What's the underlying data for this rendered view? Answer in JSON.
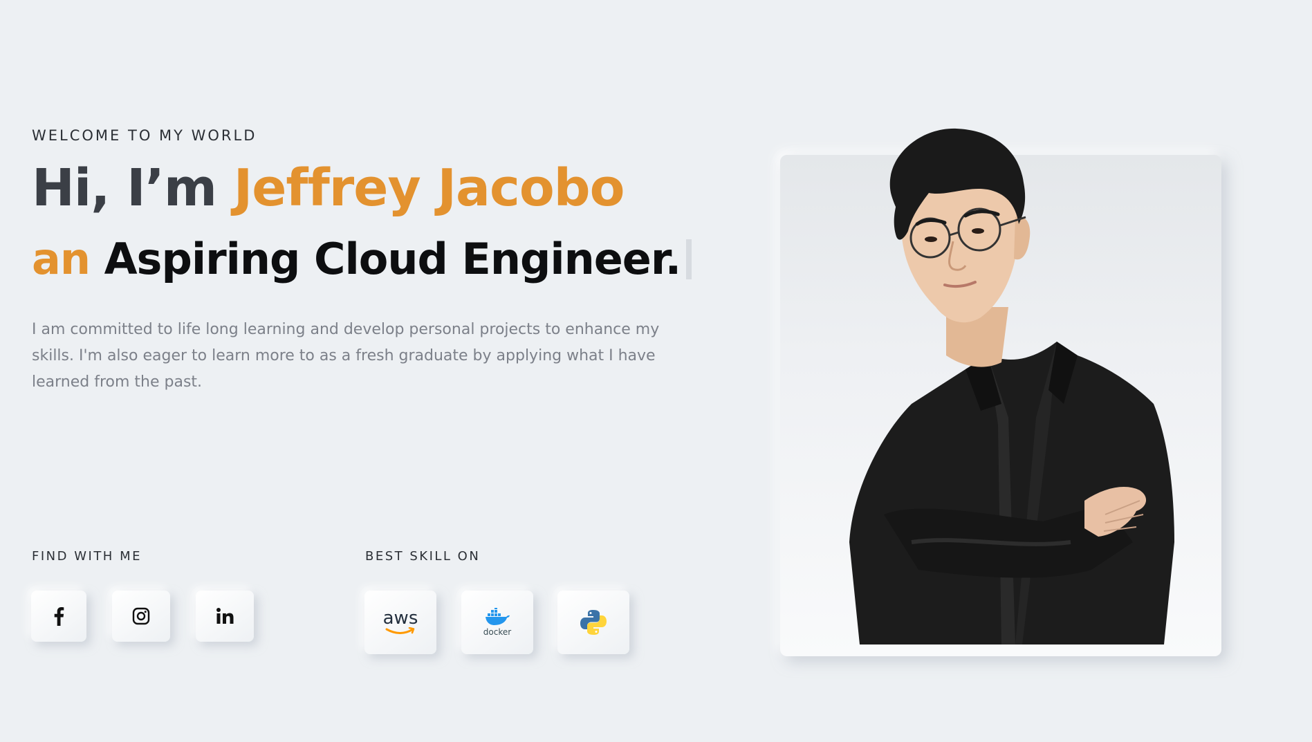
{
  "hero": {
    "eyebrow": "WELCOME TO MY WORLD",
    "greeting": "Hi, I’m ",
    "name": "Jeffrey Jacobo",
    "role_article": "an",
    "role_title": " Aspiring Cloud Engineer.",
    "intro": "I am committed to life long learning and develop personal projects to enhance my skills. I'm also eager to learn more to as a fresh graduate by applying what I have learned from the past."
  },
  "social": {
    "label": "FIND WITH ME",
    "items": [
      {
        "icon": "facebook-icon"
      },
      {
        "icon": "instagram-icon"
      },
      {
        "icon": "linkedin-icon"
      }
    ]
  },
  "skills": {
    "label": "BEST SKILL ON",
    "items": [
      {
        "icon": "aws-logo-icon",
        "text": "aws"
      },
      {
        "icon": "docker-logo-icon",
        "text": "docker"
      },
      {
        "icon": "python-logo-icon"
      }
    ]
  },
  "colors": {
    "accent": "#e3922f",
    "background": "#edf0f3",
    "heading": "#3b3f46",
    "body_text": "#7c8089"
  }
}
